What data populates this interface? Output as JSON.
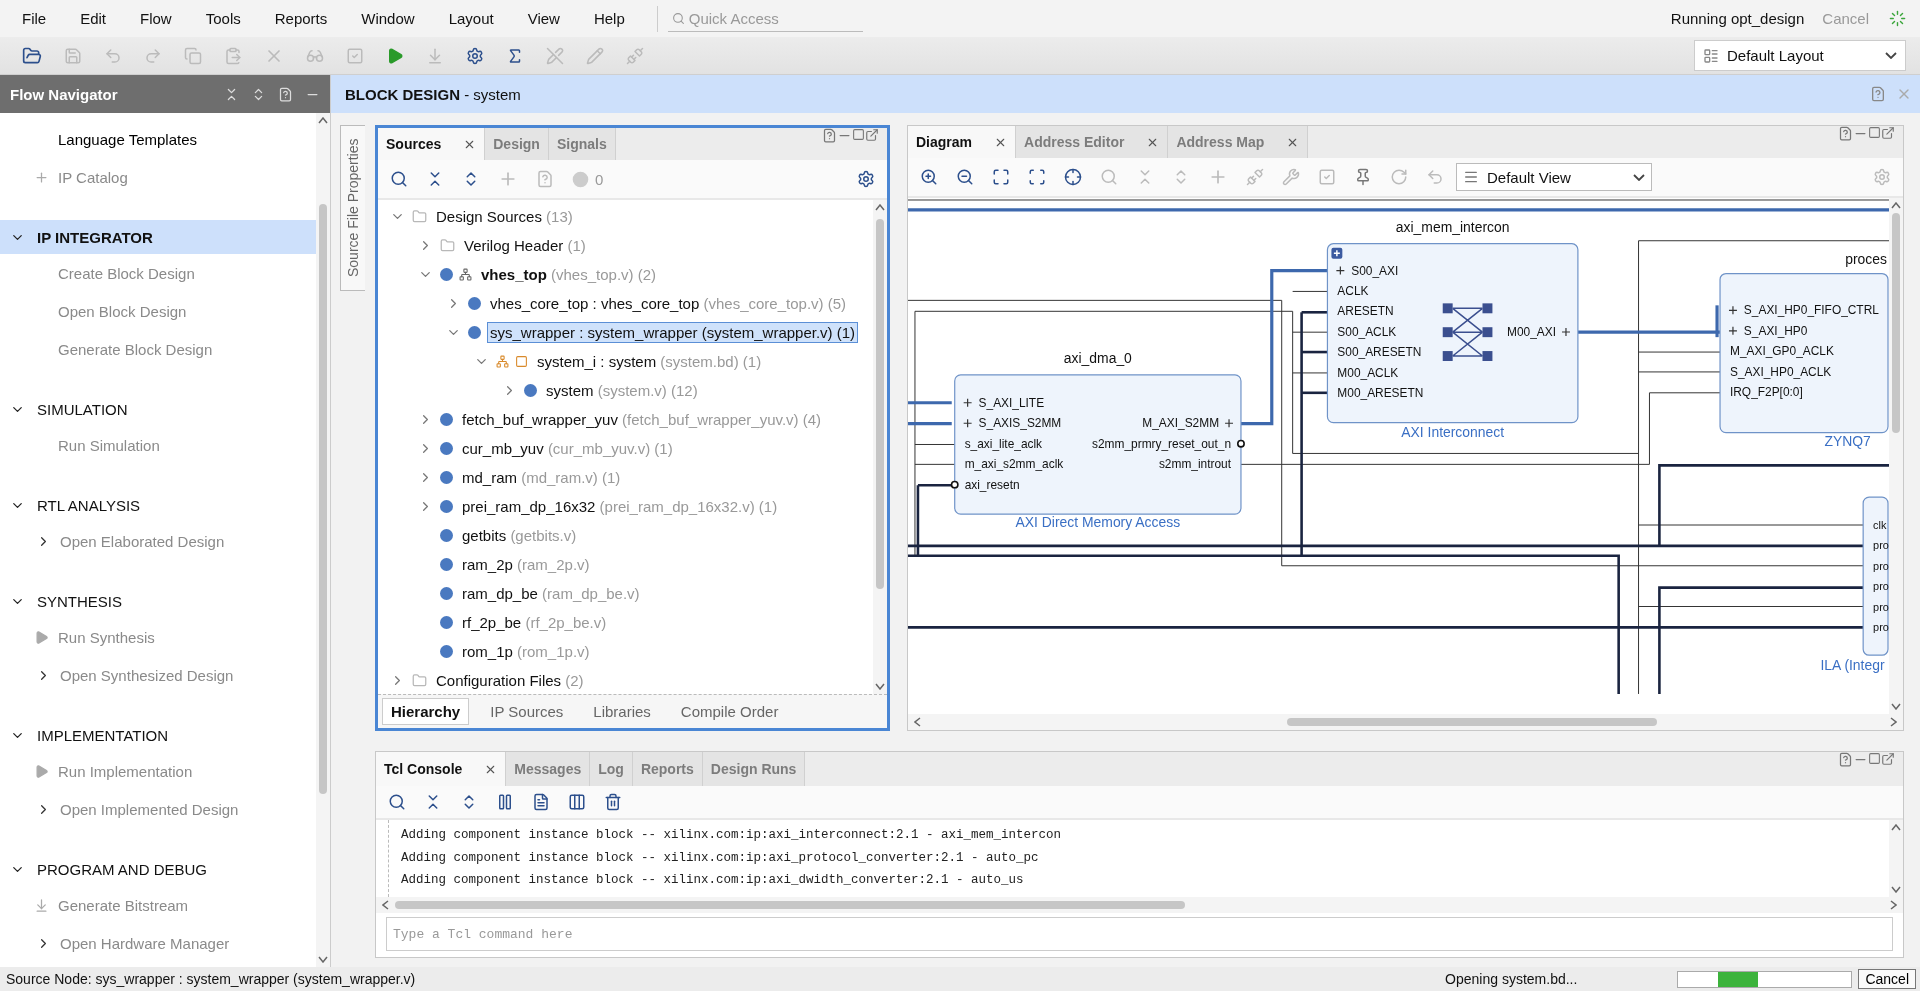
{
  "menu": [
    "File",
    "Edit",
    "Flow",
    "Tools",
    "Reports",
    "Window",
    "Layout",
    "View",
    "Help"
  ],
  "quick_access": {
    "placeholder": "Quick Access"
  },
  "run_status": {
    "text": "Running opt_design",
    "cancel": "Cancel"
  },
  "layout_select": "Default Layout",
  "flow_navigator": {
    "title": "Flow Navigator",
    "sections": [
      {
        "items": [
          {
            "label": "Language Templates",
            "kind": "plain",
            "disabled": false
          },
          {
            "label": "IP Catalog",
            "kind": "ip",
            "disabled": true
          }
        ]
      },
      {
        "title": "IP INTEGRATOR",
        "selected": true,
        "expanded": true,
        "items": [
          {
            "label": "Create Block Design",
            "kind": "plain",
            "disabled": true
          },
          {
            "label": "Open Block Design",
            "kind": "plain",
            "disabled": true
          },
          {
            "label": "Generate Block Design",
            "kind": "plain",
            "disabled": true
          }
        ]
      },
      {
        "title": "SIMULATION",
        "selected": false,
        "expanded": true,
        "items": [
          {
            "label": "Run Simulation",
            "kind": "plain",
            "disabled": true
          }
        ]
      },
      {
        "title": "RTL ANALYSIS",
        "selected": false,
        "expanded": true,
        "items": [
          {
            "label": "Open Elaborated Design",
            "kind": "chevron",
            "disabled": true
          }
        ]
      },
      {
        "title": "SYNTHESIS",
        "selected": false,
        "expanded": true,
        "items": [
          {
            "label": "Run Synthesis",
            "kind": "play",
            "disabled": true
          },
          {
            "label": "Open Synthesized Design",
            "kind": "chevron",
            "disabled": true
          }
        ]
      },
      {
        "title": "IMPLEMENTATION",
        "selected": false,
        "expanded": true,
        "items": [
          {
            "label": "Run Implementation",
            "kind": "play",
            "disabled": true
          },
          {
            "label": "Open Implemented Design",
            "kind": "chevron",
            "disabled": true
          }
        ]
      },
      {
        "title": "PROGRAM AND DEBUG",
        "selected": false,
        "expanded": true,
        "items": [
          {
            "label": "Generate Bitstream",
            "kind": "bitstream",
            "disabled": true
          },
          {
            "label": "Open Hardware Manager",
            "kind": "chevron",
            "disabled": true
          }
        ]
      }
    ]
  },
  "block_design": {
    "title": "**BLOCK DESIGN** - system"
  },
  "side_tab": "Source File Properties",
  "sources": {
    "tabs": [
      {
        "label": "Sources",
        "selected": true,
        "closable": true
      },
      {
        "label": "Design",
        "selected": false,
        "closable": false
      },
      {
        "label": "Signals",
        "selected": false,
        "closable": false
      }
    ],
    "problem_count": "0",
    "tree": [
      {
        "label": "Design Sources",
        "file": "(13)",
        "kind": "folder",
        "selected": false,
        "expanded": true,
        "children": [
          {
            "label": "Verilog Header",
            "file": "(1)",
            "kind": "folder",
            "selected": false,
            "expanded": false
          },
          {
            "label": "vhes_top",
            "file": "(vhes_top.v) (2)",
            "kind": "top",
            "selected": false,
            "expanded": true,
            "children": [
              {
                "label": "vhes_core_top : vhes_core_top",
                "file": "(vhes_core_top.v) (5)",
                "kind": "module",
                "selected": false,
                "expanded": false
              },
              {
                "label": "sys_wrapper : system_wrapper",
                "file": "(system_wrapper.v) (1)",
                "kind": "module",
                "selected": true,
                "expanded": true,
                "children": [
                  {
                    "label": "system_i : system",
                    "file": "(system.bd) (1)",
                    "kind": "bd",
                    "selected": false,
                    "expanded": true,
                    "children": [
                      {
                        "label": "system",
                        "file": "(system.v) (12)",
                        "kind": "module",
                        "selected": false,
                        "expanded": false
                      }
                    ]
                  }
                ]
              }
            ]
          },
          {
            "label": "fetch_buf_wrapper_yuv",
            "file": "(fetch_buf_wrapper_yuv.v) (4)",
            "kind": "module",
            "selected": false,
            "expanded": false
          },
          {
            "label": "cur_mb_yuv",
            "file": "(cur_mb_yuv.v) (1)",
            "kind": "module",
            "selected": false,
            "expanded": false
          },
          {
            "label": "md_ram",
            "file": "(md_ram.v) (1)",
            "kind": "module",
            "selected": false,
            "expanded": false
          },
          {
            "label": "prei_ram_dp_16x32",
            "file": "(prei_ram_dp_16x32.v) (1)",
            "kind": "module",
            "selected": false,
            "expanded": false
          },
          {
            "label": "getbits",
            "file": "(getbits.v)",
            "kind": "module",
            "selected": false
          },
          {
            "label": "ram_2p",
            "file": "(ram_2p.v)",
            "kind": "module",
            "selected": false
          },
          {
            "label": "ram_dp_be",
            "file": "(ram_dp_be.v)",
            "kind": "module",
            "selected": false
          },
          {
            "label": "rf_2p_be",
            "file": "(rf_2p_be.v)",
            "kind": "module",
            "selected": false
          },
          {
            "label": "rom_1p",
            "file": "(rom_1p.v)",
            "kind": "module",
            "selected": false
          }
        ]
      },
      {
        "label": "Configuration Files",
        "file": "(2)",
        "kind": "folder",
        "selected": false,
        "expanded": false
      }
    ],
    "bottom_tabs": [
      {
        "label": "Hierarchy",
        "selected": true
      },
      {
        "label": "IP Sources",
        "selected": false
      },
      {
        "label": "Libraries",
        "selected": false
      },
      {
        "label": "Compile Order",
        "selected": false
      }
    ]
  },
  "diagram": {
    "tabs": [
      {
        "label": "Diagram",
        "selected": true,
        "closable": true
      },
      {
        "label": "Address Editor",
        "selected": false,
        "closable": true
      },
      {
        "label": "Address Map",
        "selected": false,
        "closable": true
      }
    ],
    "view": "Default View",
    "blocks": [
      {
        "title": "axi_dma_0",
        "caption": "AXI Direct Memory Access",
        "left": [
          {
            "label": "S_AXI_LITE",
            "kind": "bus"
          },
          {
            "label": "S_AXIS_S2MM",
            "kind": "bus"
          },
          {
            "label": "s_axi_lite_aclk",
            "kind": "pin"
          },
          {
            "label": "m_axi_s2mm_aclk",
            "kind": "pin"
          },
          {
            "label": "axi_resetn",
            "kind": "inverted"
          }
        ],
        "right": [
          {
            "label": "M_AXI_S2MM",
            "kind": "bus"
          },
          {
            "label": "s2mm_prmry_reset_out_n",
            "kind": "inverted"
          },
          {
            "label": "s2mm_introut",
            "kind": "pin"
          }
        ]
      },
      {
        "title": "axi_mem_intercon",
        "caption": "AXI Interconnect",
        "left": [
          {
            "label": "S00_AXI",
            "kind": "bus"
          },
          {
            "label": "ACLK",
            "kind": "pin"
          },
          {
            "label": "ARESETN",
            "kind": "pin"
          },
          {
            "label": "S00_ACLK",
            "kind": "pin"
          },
          {
            "label": "S00_ARESETN",
            "kind": "pin"
          },
          {
            "label": "M00_ACLK",
            "kind": "pin"
          },
          {
            "label": "M00_ARESETN",
            "kind": "pin"
          }
        ],
        "right": [
          {
            "label": "M00_AXI",
            "kind": "bus"
          }
        ]
      },
      {
        "title": "proces",
        "caption": "ZYNQ7",
        "left": [
          {
            "label": "S_AXI_HP0_FIFO_CTRL",
            "kind": "bus"
          },
          {
            "label": "S_AXI_HP0",
            "kind": "bus"
          },
          {
            "label": "M_AXI_GP0_ACLK",
            "kind": "pin"
          },
          {
            "label": "S_AXI_HP0_ACLK",
            "kind": "pin"
          },
          {
            "label": "IRQ_F2P[0:0]",
            "kind": "pin"
          }
        ]
      },
      {
        "caption": "ILA (Integr",
        "left": [
          {
            "label": "clk",
            "kind": "pin"
          },
          {
            "label": "pro",
            "kind": "pin"
          },
          {
            "label": "pro",
            "kind": "pin"
          },
          {
            "label": "pro",
            "kind": "pin"
          },
          {
            "label": "pro",
            "kind": "pin"
          },
          {
            "label": "pro",
            "kind": "pin"
          }
        ]
      }
    ]
  },
  "console": {
    "tabs": [
      {
        "label": "Tcl Console",
        "selected": true,
        "closable": true
      },
      {
        "label": "Messages",
        "selected": false,
        "closable": false
      },
      {
        "label": "Log",
        "selected": false,
        "closable": false
      },
      {
        "label": "Reports",
        "selected": false,
        "closable": false
      },
      {
        "label": "Design Runs",
        "selected": false,
        "closable": false
      }
    ],
    "lines": [
      "Adding component instance block -- xilinx.com:ip:axi_interconnect:2.1 - axi_mem_intercon",
      "Adding component instance block -- xilinx.com:ip:axi_protocol_converter:2.1 - auto_pc",
      "Adding component instance block -- xilinx.com:ip:axi_dwidth_converter:2.1 - auto_us"
    ],
    "placeholder": "Type a Tcl command here"
  },
  "status_bar": {
    "source_node": "Source Node: sys_wrapper : system_wrapper (system_wrapper.v)",
    "message": "Opening system.bd...",
    "cancel": "Cancel"
  }
}
